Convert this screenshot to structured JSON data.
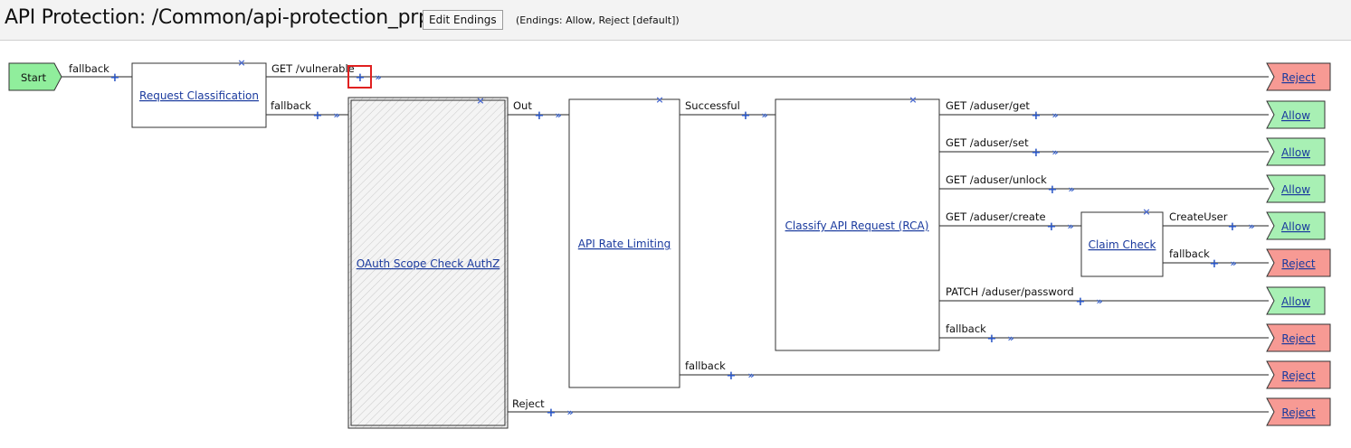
{
  "header": {
    "title": "API Protection: /Common/api-protection_prp",
    "edit_button": "Edit Endings",
    "endings_note": "(Endings: Allow, Reject [default])"
  },
  "start": {
    "label": "Start"
  },
  "boxes": {
    "request_classification": "Request Classification",
    "oauth_scope": "OAuth Scope Check AuthZ",
    "rate_limiting": "API Rate Limiting",
    "classify_rca": "Classify API Request (RCA)",
    "claim_check": "Claim Check"
  },
  "branches": {
    "start_fallback": "fallback",
    "get_vulnerable": "GET /vulnerable",
    "rc_fallback": "fallback",
    "oauth_out": "Out",
    "oauth_reject": "Reject",
    "rl_successful": "Successful",
    "rl_fallback": "fallback",
    "rca_get": "GET /aduser/get",
    "rca_set": "GET /aduser/set",
    "rca_unlock": "GET /aduser/unlock",
    "rca_create": "GET /aduser/create",
    "rca_patch": "PATCH /aduser/password",
    "rca_fallback": "fallback",
    "cc_createuser": "CreateUser",
    "cc_fallback": "fallback"
  },
  "endings": {
    "e1": "Reject",
    "e2": "Allow",
    "e3": "Allow",
    "e4": "Allow",
    "e5": "Allow",
    "e6": "Reject",
    "e7": "Allow",
    "e8": "Reject",
    "e9": "Reject",
    "e10": "Reject"
  },
  "icons": {
    "plus": "+",
    "arrow": "»",
    "close": "×"
  },
  "colors": {
    "allow_fill": "#a8f0b4",
    "reject_fill": "#f79a94",
    "start_fill": "#90ee9c",
    "link": "#1a3a9e",
    "connector": "#2a56c6",
    "highlight": "#e02020"
  }
}
